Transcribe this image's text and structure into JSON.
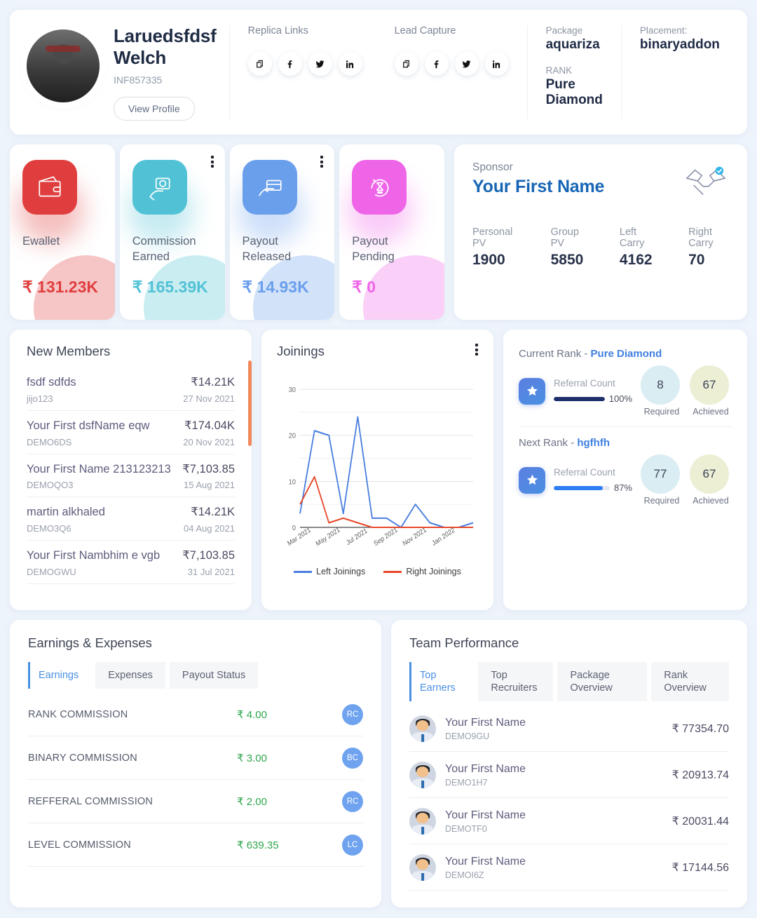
{
  "profile": {
    "name": "Laruedsfdsf Welch",
    "id": "INF857335",
    "view_profile": "View Profile",
    "replica_links_label": "Replica Links",
    "lead_capture_label": "Lead Capture",
    "social_icons": [
      "copy-icon",
      "facebook-icon",
      "twitter-icon",
      "linkedin-icon"
    ],
    "package_label": "Package",
    "package_value": "aquariza",
    "rank_label": "RANK",
    "rank_value": "Pure Diamond",
    "placement_label": "Placement:",
    "placement_value": "binaryaddon"
  },
  "stats": [
    {
      "label": "Ewallet",
      "value": "₹ 131.23K",
      "color": "#e03e3e",
      "icon": "wallet-icon",
      "menu": false
    },
    {
      "label": "Commission Earned",
      "value": "₹ 165.39K",
      "color": "#51c2d5",
      "icon": "hand-coin-icon",
      "menu": true
    },
    {
      "label": "Payout Released",
      "value": "₹ 14.93K",
      "color": "#6a9fec",
      "icon": "hand-card-icon",
      "menu": true
    },
    {
      "label": "Payout Pending",
      "value": "₹ 0",
      "color": "#ef65e8",
      "icon": "hourglass-icon",
      "menu": false
    }
  ],
  "sponsor": {
    "label": "Sponsor",
    "name": "Your First Name",
    "icon": "handshake-icon",
    "metrics": [
      {
        "key": "Personal PV",
        "value": "1900"
      },
      {
        "key": "Group PV",
        "value": "5850"
      },
      {
        "key": "Left Carry",
        "value": "4162"
      },
      {
        "key": "Right Carry",
        "value": "70"
      }
    ]
  },
  "new_members": {
    "title": "New Members",
    "rows": [
      {
        "name": "fsdf sdfds",
        "amount": "₹14.21K",
        "sub": "jijo123",
        "date": "27 Nov 2021"
      },
      {
        "name": "Your First dsfName eqw",
        "amount": "₹174.04K",
        "sub": "DEMO6DS",
        "date": "20 Nov 2021"
      },
      {
        "name": "Your First Name 213123213",
        "amount": "₹7,103.85",
        "sub": "DEMOQO3",
        "date": "15 Aug 2021"
      },
      {
        "name": "martin alkhaled",
        "amount": "₹14.21K",
        "sub": "DEMO3Q6",
        "date": "04 Aug 2021"
      },
      {
        "name": "Your First Nambhim e vgb",
        "amount": "₹7,103.85",
        "sub": "DEMOGWU",
        "date": "31 Jul 2021"
      }
    ]
  },
  "joinings": {
    "title": "Joinings",
    "menu_icon": "kebab-menu-icon"
  },
  "chart_data": {
    "type": "line",
    "title": "Joinings",
    "xlabel": "",
    "ylabel": "",
    "ylim": [
      0,
      32
    ],
    "yticks": [
      0,
      10,
      20,
      30
    ],
    "grid": true,
    "legend_position": "bottom",
    "x": [
      "Mar 2021",
      "Apr 2021",
      "May 2021",
      "Jun 2021",
      "Jul 2021",
      "Aug 2021",
      "Sep 2021",
      "Oct 2021",
      "Nov 2021",
      "Dec 2021",
      "Jan 2022",
      "Feb 2022",
      "Mar 2022"
    ],
    "tick_labels": [
      "Mar 2021",
      "May 2021",
      "Jul 2021",
      "Sep 2021",
      "Nov 2021",
      "Jan 2022"
    ],
    "series": [
      {
        "name": "Left Joinings",
        "color": "#4a7fe0",
        "values": [
          3,
          21,
          20,
          3,
          24,
          2,
          2,
          0,
          5,
          1,
          0,
          0,
          1
        ]
      },
      {
        "name": "Right Joinings",
        "color": "#e8492b",
        "values": [
          5,
          11,
          1,
          2,
          1,
          0,
          0,
          0,
          0,
          0,
          0,
          0,
          0
        ]
      }
    ]
  },
  "ranks": [
    {
      "head_prefix": "Current Rank - ",
      "head_rank": "Pure Diamond",
      "metric_label": "Referral Count",
      "percent": "100%",
      "percent_value": 100,
      "bar_color": "#1f2f6b",
      "required": "8",
      "achieved": "67",
      "required_caption": "Required",
      "achieved_caption": "Achieved"
    },
    {
      "head_prefix": "Next Rank - ",
      "head_rank": "hgfhfh",
      "metric_label": "Referral Count",
      "percent": "87%",
      "percent_value": 87,
      "bar_color": "#2f7ef5",
      "required": "77",
      "achieved": "67",
      "required_caption": "Required",
      "achieved_caption": "Achieved"
    }
  ],
  "earnings": {
    "title": "Earnings & Expenses",
    "tabs": [
      "Earnings",
      "Expenses",
      "Payout Status"
    ],
    "active_tab": "Earnings",
    "rows": [
      {
        "name": "RANK COMMISSION",
        "amount": "₹ 4.00",
        "badge": "RC"
      },
      {
        "name": "BINARY COMMISSION",
        "amount": "₹ 3.00",
        "badge": "BC"
      },
      {
        "name": "REFFERAL COMMISSION",
        "amount": "₹ 2.00",
        "badge": "RC"
      },
      {
        "name": "LEVEL COMMISSION",
        "amount": "₹ 639.35",
        "badge": "LC"
      }
    ]
  },
  "team": {
    "title": "Team Performance",
    "tabs": [
      "Top Earners",
      "Top Recruiters",
      "Package Overview",
      "Rank Overview"
    ],
    "active_tab": "Top Earners",
    "rows": [
      {
        "name": "Your First Name",
        "sub": "DEMO9GU",
        "amount": "₹ 77354.70"
      },
      {
        "name": "Your First Name",
        "sub": "DEMO1H7",
        "amount": "₹ 20913.74"
      },
      {
        "name": "Your First Name",
        "sub": "DEMOTF0",
        "amount": "₹ 20031.44"
      },
      {
        "name": "Your First Name",
        "sub": "DEMOI6Z",
        "amount": "₹ 17144.56"
      }
    ]
  }
}
